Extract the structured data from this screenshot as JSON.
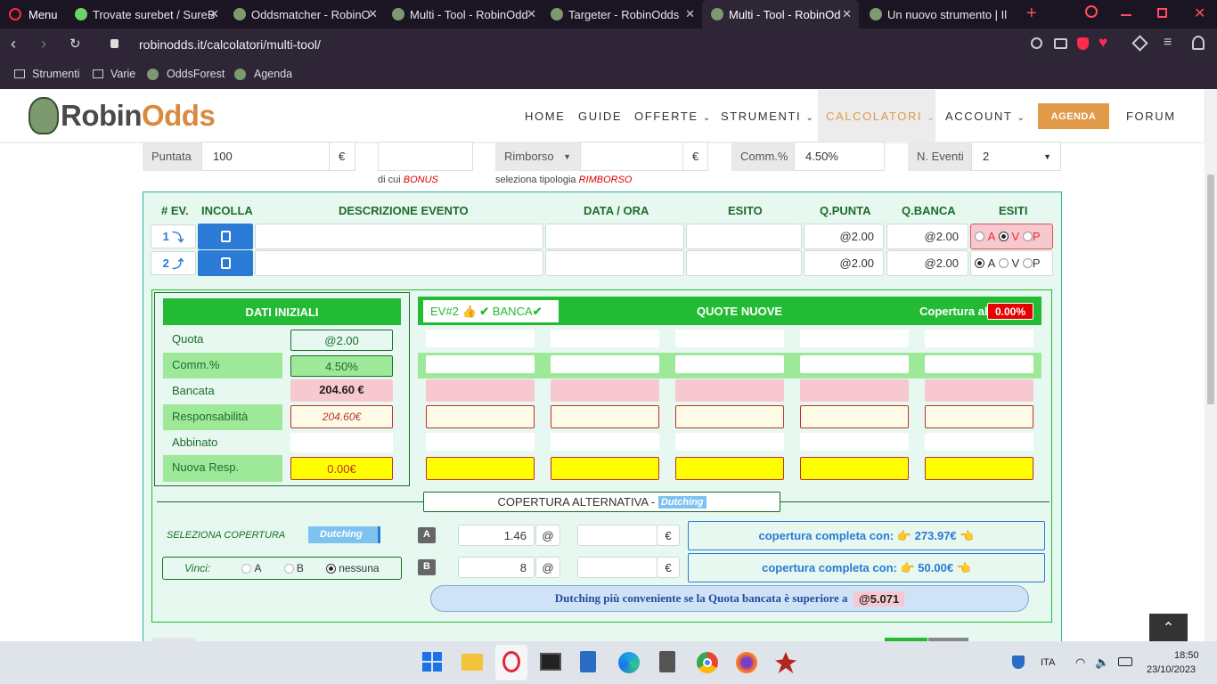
{
  "browser": {
    "menu_label": "Menu",
    "tabs": [
      {
        "title": "Trovate surebet / SureB",
        "active": false
      },
      {
        "title": "Oddsmatcher - RobinO",
        "active": false
      },
      {
        "title": "Multi - Tool - RobinOdd",
        "active": false
      },
      {
        "title": "Targeter - RobinOdds",
        "active": false
      },
      {
        "title": "Multi - Tool - RobinOd",
        "active": true
      },
      {
        "title": "Un nuovo strumento | Il",
        "active": false
      }
    ],
    "url": "robinodds.it/calcolatori/multi-tool/",
    "bookmarks": [
      "Strumenti",
      "Varie",
      "OddsForest",
      "Agenda"
    ]
  },
  "site": {
    "logo_text_1": "Robin",
    "logo_text_2": "Odds",
    "nav": [
      "HOME",
      "GUIDE",
      "OFFERTE",
      "STRUMENTI",
      "CALCOLATORI",
      "ACCOUNT",
      "AGENDA",
      "FORUM"
    ]
  },
  "top_inputs": {
    "puntata_label": "Puntata",
    "puntata_value": "100",
    "currency": "€",
    "bonus_note_prefix": "di cui",
    "bonus_note": "BONUS",
    "rimborso_label": "Rimborso",
    "rimborso_note_prefix": "seleziona tipologia",
    "rimborso_note": "RIMBORSO",
    "comm_label": "Comm.%",
    "comm_value": "4.50%",
    "eventi_label": "N. Eventi",
    "eventi_value": "2"
  },
  "events_table": {
    "headers": [
      "# EV.",
      "INCOLLA",
      "DESCRIZIONE EVENTO",
      "DATA / ORA",
      "ESITO",
      "Q.PUNTA",
      "Q.BANCA",
      "ESITI"
    ],
    "rows": [
      {
        "num": "1",
        "arrow": "⤵",
        "q_punta": "@2.00",
        "q_banca": "@2.00",
        "opt_a": "A",
        "opt_v": "V",
        "opt_p": "P"
      },
      {
        "num": "2",
        "arrow": "⤴",
        "q_punta": "@2.00",
        "q_banca": "@2.00",
        "opt_a": "A",
        "opt_v": "V",
        "opt_p": "P"
      }
    ]
  },
  "dati_iniziali": {
    "title": "DATI INIZIALI",
    "rows": [
      {
        "label": "Quota",
        "value": "@2.00"
      },
      {
        "label": "Comm.%",
        "value": "4.50%"
      },
      {
        "label": "Bancata",
        "value": "204.60 €"
      },
      {
        "label": "Responsabilità",
        "value": "204.60€"
      },
      {
        "label": "Abbinato",
        "value": ""
      },
      {
        "label": "Nuova Resp.",
        "value": "0.00€"
      }
    ]
  },
  "quote_nuove": {
    "ev_badge": "EV#2",
    "banca_badge": "BANCA",
    "title": "QUOTE NUOVE",
    "copertura_label": "Copertura al:",
    "copertura_value": "0.00%"
  },
  "copertura_alt": {
    "title": "COPERTURA ALTERNATIVA -",
    "title_badge": "Dutching",
    "seleziona_label": "SELEZIONA COPERTURA",
    "select_value": "Dutching",
    "vinci_label": "Vinci:",
    "vinci_options": [
      "A",
      "B",
      "nessuna"
    ],
    "row_a": {
      "tag": "A",
      "quota": "1.46",
      "at": "@",
      "currency": "€",
      "result_prefix": "copertura completa con:",
      "result": "273.97€"
    },
    "row_b": {
      "tag": "B",
      "quota": "8",
      "at": "@",
      "currency": "€",
      "result_prefix": "copertura completa con:",
      "result": "50.00€"
    },
    "note": "Dutching più conveniente se la Quota bancata è superiore a",
    "note_value": "@5.071"
  },
  "taskbar": {
    "lang": "ITA",
    "time": "18:50",
    "date": "23/10/2023"
  },
  "colors": {
    "green": "#22bb33",
    "light_green": "#9ee89a",
    "panel_bg": "#e6f8ef",
    "pink": "#f7c8d0",
    "yellow": "#ffff00",
    "blue_button": "#2a7ad6",
    "agenda_orange": "#e09a48",
    "red_badge": "#e60000"
  }
}
